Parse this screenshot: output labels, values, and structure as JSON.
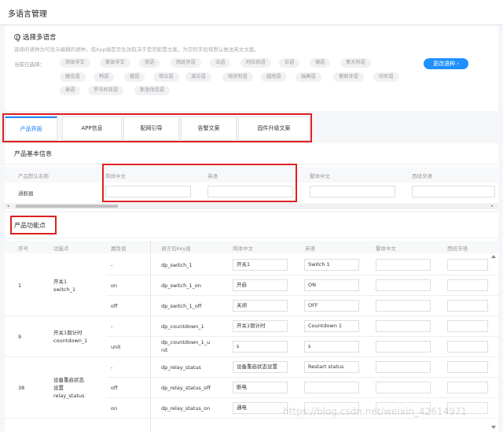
{
  "header": {
    "title": "多语言管理"
  },
  "language_select": {
    "title": "选择多语言",
    "description": "选择的语种为可显示编辑的语种，但App端是否生效取决于是否配置文案。为空的字段将默认推送英文文案。",
    "current_label": "当前已选择：",
    "languages": [
      "简体中文",
      "繁体中文",
      "英语",
      "西班牙语",
      "法语",
      "阿拉伯语",
      "日语",
      "德语",
      "意大利语",
      "捷克语",
      "韩语",
      "俄语",
      "荷兰语",
      "波兰语",
      "匈牙利语",
      "越南语",
      "瑞典语",
      "葡萄牙语",
      "印尼语",
      "泰语",
      "罗马尼亚语",
      "斯洛伐克语"
    ],
    "change_button": "更改语种 ›"
  },
  "tabs": [
    "产品界面",
    "APP信息",
    "配网引导",
    "告警文案",
    "固件升级文案"
  ],
  "basic_info": {
    "title": "产品基本信息",
    "columns": [
      "产品默认名称",
      "简体中文",
      "英语",
      "繁体中文",
      "西班牙语"
    ],
    "default_name": "通断器",
    "scroll_left": "◂",
    "scroll_right": "▸"
  },
  "functions": {
    "title": "产品功能点",
    "columns": [
      "序号",
      "功能点",
      "属性值",
      "语言包Key值",
      "简体中文",
      "英语",
      "繁体中文",
      "西班牙语"
    ],
    "groups": [
      {
        "no": "1",
        "name": "开关1\nswitch_1",
        "rows": [
          {
            "attr": "-",
            "key": "dp_switch_1",
            "zh": "开关1",
            "en": "Switch 1"
          },
          {
            "attr": "on",
            "key": "dp_switch_1_on",
            "zh": "开启",
            "en": "ON"
          },
          {
            "attr": "off",
            "key": "dp_switch_1_off",
            "zh": "关闭",
            "en": "OFF"
          }
        ]
      },
      {
        "no": "9",
        "name": "开关1倒计时\ncountdown_1",
        "rows": [
          {
            "attr": "-",
            "key": "dp_countdown_1",
            "zh": "开关1倒计时",
            "en": "Countdown 1"
          },
          {
            "attr": "unit",
            "key": "dp_countdown_1_u\nnit",
            "zh": "s",
            "en": "s"
          }
        ]
      },
      {
        "no": "38",
        "name": "设备重启状态\n设置\nrelay_status",
        "rows": [
          {
            "attr": "-",
            "key": "dp_relay_status",
            "zh": "设备重启状态设置",
            "en": "Restart status"
          },
          {
            "attr": "off",
            "key": "dp_relay_status_off",
            "zh": "断电",
            "en": ""
          },
          {
            "attr": "on",
            "key": "dp_relay_status_on",
            "zh": "通电",
            "en": ""
          }
        ]
      }
    ]
  },
  "watermark": "https://blog.csdn.net/weixin_42614971"
}
